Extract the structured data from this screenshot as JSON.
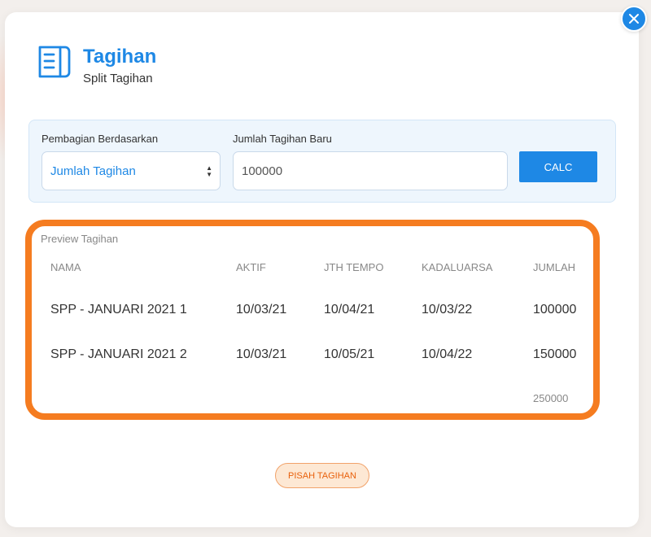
{
  "header": {
    "title": "Tagihan",
    "subtitle": "Split Tagihan",
    "icon": "document-icon"
  },
  "form": {
    "split_by_label": "Pembagian Berdasarkan",
    "split_by_value": "Jumlah Tagihan",
    "new_amount_label": "Jumlah Tagihan Baru",
    "new_amount_value": "100000",
    "calc_label": "CALC"
  },
  "preview": {
    "title": "Preview Tagihan",
    "columns": [
      "NAMA",
      "AKTIF",
      "JTH TEMPO",
      "KADALUARSA",
      "JUMLAH"
    ],
    "rows": [
      {
        "nama": "SPP - JANUARI 2021 1",
        "aktif": "10/03/21",
        "jth_tempo": "10/04/21",
        "kadaluarsa": "10/03/22",
        "jumlah": "100000"
      },
      {
        "nama": "SPP - JANUARI 2021 2",
        "aktif": "10/03/21",
        "jth_tempo": "10/05/21",
        "kadaluarsa": "10/04/22",
        "jumlah": "150000"
      }
    ],
    "total": "250000"
  },
  "footer": {
    "split_button_label": "PISAH TAGIHAN"
  },
  "colors": {
    "accent": "#1e88e5",
    "highlight_border": "#f57c20",
    "split_button_bg": "#fde8d4",
    "split_button_text": "#e8600c"
  }
}
